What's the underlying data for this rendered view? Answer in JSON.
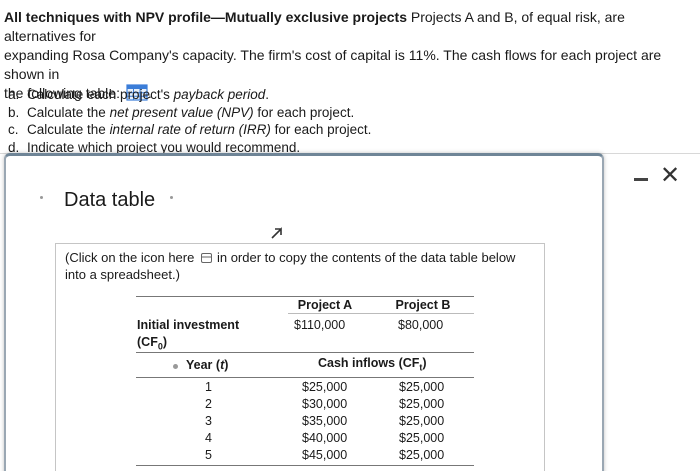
{
  "problem": {
    "title": "All techniques with NPV profile—Mutually exclusive projects",
    "line1_rest": "Projects A and B, of equal risk, are alternatives for",
    "line2": "expanding Rosa Company's capacity. The firm's cost of capital is 11%. The cash flows for each project are shown in",
    "line3": "the following table:"
  },
  "tasks": [
    {
      "letter": "a.",
      "pre": "Calculate each project's ",
      "italic": "payback period",
      "post": "."
    },
    {
      "letter": "b.",
      "pre": "Calculate the ",
      "italic": "net present value (NPV)",
      "post": " for each project."
    },
    {
      "letter": "c.",
      "pre": "Calculate the ",
      "italic": "internal rate of return (IRR)",
      "post": " for each project."
    },
    {
      "letter": "d.",
      "pre": "Indicate which project you would recommend.",
      "italic": "",
      "post": ""
    }
  ],
  "modal": {
    "title": "Data table",
    "instruction_line1_a": "(Click on the icon here",
    "instruction_line1_b": "in order to copy the contents of the data table below",
    "instruction_line2": "into a spreadsheet.)"
  },
  "table": {
    "col_a": "Project A",
    "col_b": "Project B",
    "initial_label": "Initial investment",
    "initial_sub": "(CF",
    "initial_sub_index": "0",
    "initial_sub_close": ")",
    "initial_a": "$110,000",
    "initial_b": "$80,000",
    "year_label": "Year (",
    "year_italic": "t",
    "year_close": ")",
    "cash_label": "Cash inflows (CF",
    "cash_index": "t",
    "cash_close": ")",
    "rows": [
      {
        "year": "1",
        "a": "$25,000",
        "b": "$25,000"
      },
      {
        "year": "2",
        "a": "$30,000",
        "b": "$25,000"
      },
      {
        "year": "3",
        "a": "$35,000",
        "b": "$25,000"
      },
      {
        "year": "4",
        "a": "$40,000",
        "b": "$25,000"
      },
      {
        "year": "5",
        "a": "$45,000",
        "b": "$25,000"
      }
    ]
  }
}
